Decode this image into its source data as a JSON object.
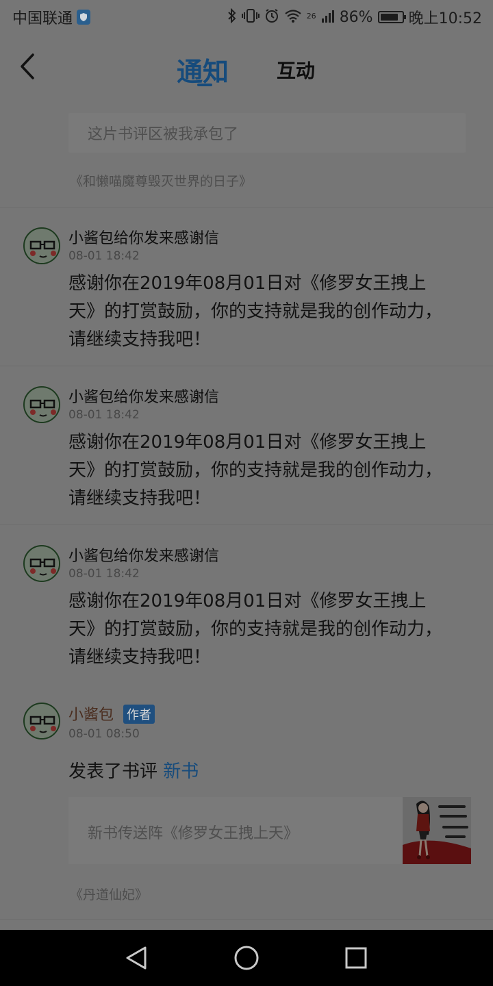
{
  "status_bar": {
    "carrier": "中国联通",
    "network_label": "26",
    "battery_percent": "86%",
    "battery_level": 0.86,
    "time": "晚上10:52"
  },
  "header": {
    "tab_notify": "通知",
    "tab_interact": "互动"
  },
  "top_comment": {
    "quote": "这片书评区被我承包了",
    "book": "《和懒喵魔尊毁灭世界的日子》"
  },
  "messages": [
    {
      "title": "小酱包给你发来感谢信",
      "time": "08-01 18:42",
      "body_line1": "感谢你在2019年08月01日对《修罗女王拽上",
      "body_line2": "天》的打赏鼓励，你的支持就是我的创作动力，",
      "body_line3": "请继续支持我吧！"
    },
    {
      "title": "小酱包给你发来感谢信",
      "time": "08-01 18:42",
      "body_line1": "感谢你在2019年08月01日对《修罗女王拽上",
      "body_line2": "天》的打赏鼓励，你的支持就是我的创作动力，",
      "body_line3": "请继续支持我吧！"
    },
    {
      "title": "小酱包给你发来感谢信",
      "time": "08-01 18:42",
      "body_line1": "感谢你在2019年08月01日对《修罗女王拽上",
      "body_line2": "天》的打赏鼓励，你的支持就是我的创作动力，",
      "body_line3": "请继续支持我吧！"
    }
  ],
  "author_post": {
    "name": "小酱包",
    "badge": "作者",
    "time": "08-01 08:50",
    "action": "发表了书评",
    "tag": "新书",
    "card_text": "新书传送阵《修罗女王拽上天》",
    "book": "《丹道仙妃》"
  },
  "icons": {
    "back": "chevron-left-icon",
    "shield": "shield-icon",
    "nav_back": "triangle-back-icon",
    "nav_home": "circle-home-icon",
    "nav_recent": "square-recent-icon"
  }
}
